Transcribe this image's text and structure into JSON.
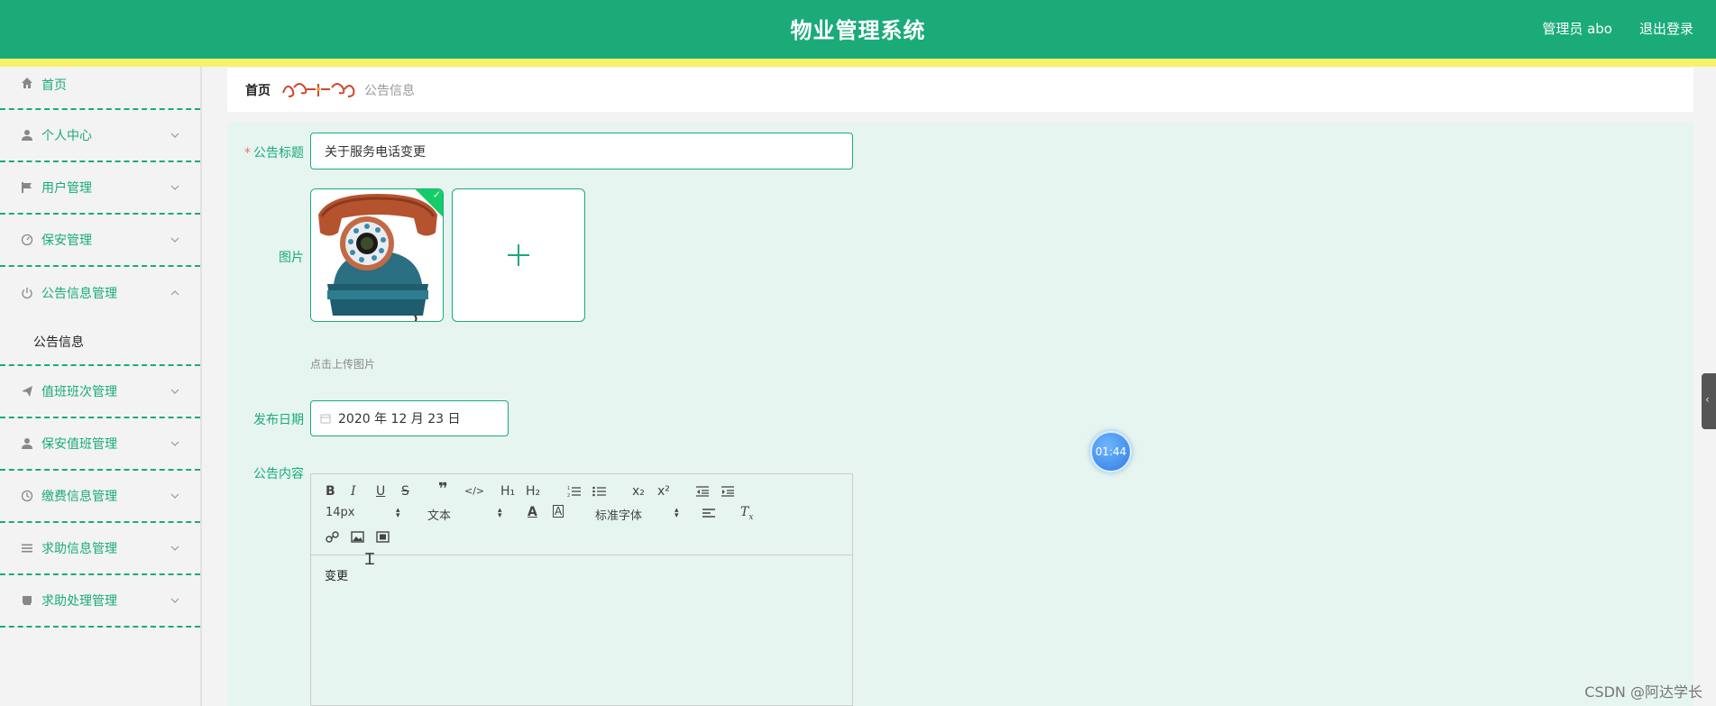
{
  "header": {
    "title": "物业管理系统",
    "user": "管理员 abo",
    "logout": "退出登录"
  },
  "sidebar": {
    "items": [
      {
        "label": "首页",
        "icon": "home-icon"
      },
      {
        "label": "个人中心",
        "icon": "user-icon"
      },
      {
        "label": "用户管理",
        "icon": "flag-icon"
      },
      {
        "label": "保安管理",
        "icon": "gauge-icon"
      },
      {
        "label": "公告信息管理",
        "icon": "power-icon",
        "expanded": true
      },
      {
        "label": "值班班次管理",
        "icon": "send-icon"
      },
      {
        "label": "保安值班管理",
        "icon": "user-icon"
      },
      {
        "label": "缴费信息管理",
        "icon": "clock-icon"
      },
      {
        "label": "求助信息管理",
        "icon": "list-icon"
      },
      {
        "label": "求助处理管理",
        "icon": "box-icon"
      }
    ],
    "submenu": {
      "label": "公告信息"
    }
  },
  "breadcrumb": {
    "home": "首页",
    "current": "公告信息"
  },
  "form": {
    "title_label": "公告标题",
    "title_required": "*",
    "title_value": "关于服务电话变更",
    "image_label": "图片",
    "upload_tip": "点击上传图片",
    "date_label": "发布日期",
    "date_value": "2020 年 12 月 23 日",
    "content_label": "公告内容",
    "content_value": "变更"
  },
  "editor": {
    "font_size": "14px",
    "heading": "文本",
    "font_family": "标准字体",
    "h1": "H₁",
    "h2": "H₂"
  },
  "overlay": {
    "timer": "01:44",
    "watermark": "CSDN @阿达学长"
  },
  "colors": {
    "primary": "#1aab79",
    "accent_bar": "#f7f26a",
    "form_bg": "#e6f5ef"
  }
}
